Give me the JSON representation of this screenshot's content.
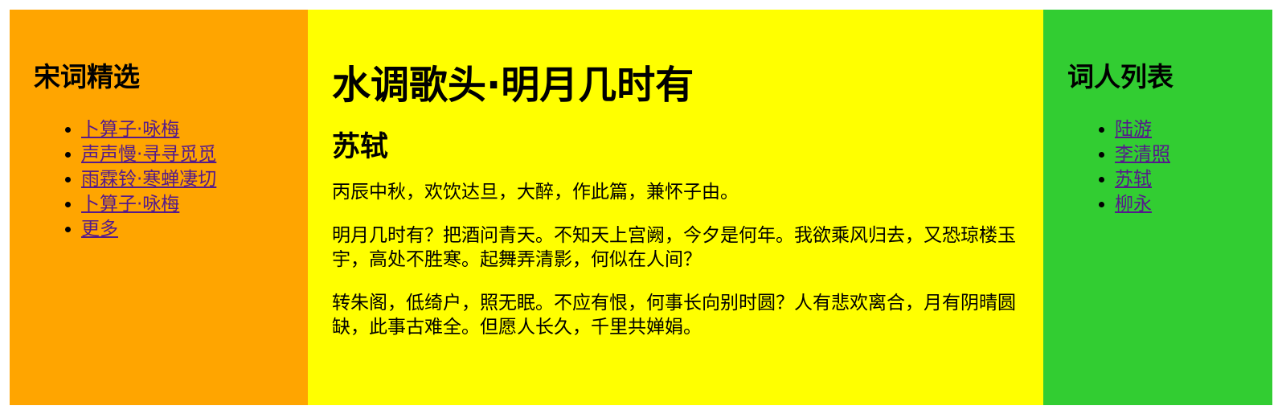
{
  "left_panel": {
    "title": "宋词精选",
    "links": [
      "卜算子·咏梅",
      "声声慢·寻寻觅觅",
      "雨霖铃·寒蝉凄切",
      "卜算子·咏梅",
      "更多"
    ]
  },
  "main": {
    "title": "水调歌头·明月几时有",
    "author": "苏轼",
    "preface": "丙辰中秋，欢饮达旦，大醉，作此篇，兼怀子由。",
    "stanzas": [
      "明月几时有？把酒问青天。不知天上宫阙，今夕是何年。我欲乘风归去，又恐琼楼玉宇，高处不胜寒。起舞弄清影，何似在人间？",
      "转朱阁，低绮户，照无眠。不应有恨，何事长向别时圆？人有悲欢离合，月有阴晴圆缺，此事古难全。但愿人长久，千里共婵娟。"
    ]
  },
  "right_panel": {
    "title": "词人列表",
    "links": [
      "陆游",
      "李清照",
      "苏轼",
      "柳永"
    ]
  },
  "colors": {
    "left_bg": "#ffa500",
    "main_bg": "#ffff00",
    "right_bg": "#32cd32",
    "link": "#551a8b"
  }
}
